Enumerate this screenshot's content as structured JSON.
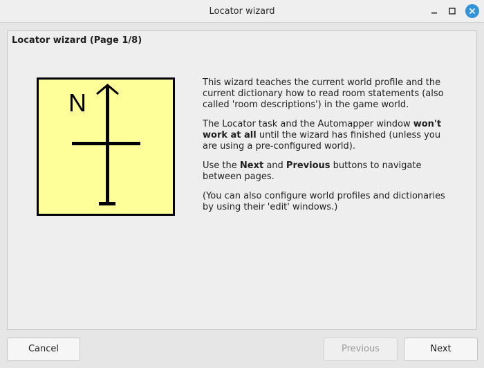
{
  "window": {
    "title": "Locator wizard",
    "controls": {
      "minimize": "minimize-icon",
      "maximize": "maximize-icon",
      "close": "close-icon"
    }
  },
  "wizard": {
    "page_title": "Locator wizard (Page 1/8)",
    "compass_letter": "N",
    "paragraphs": {
      "p1": "This wizard teaches the current world profile and the current dictionary how to read room statements (also called 'room descriptions') in the game world.",
      "p2_a": "The Locator task and the Automapper window ",
      "p2_b": "won't work at all",
      "p2_c": " until the wizard has finished (unless you are using a pre-configured world).",
      "p3_a": "Use the ",
      "p3_b": "Next",
      "p3_c": " and ",
      "p3_d": "Previous",
      "p3_e": " buttons to navigate between pages.",
      "p4": "(You can also configure world profiles and dictionaries by using their 'edit' windows.)"
    }
  },
  "buttons": {
    "cancel": "Cancel",
    "previous": "Previous",
    "next": "Next",
    "previous_enabled": false
  },
  "colors": {
    "compass_fill": "#ffff99",
    "close_button": "#3393d6"
  }
}
